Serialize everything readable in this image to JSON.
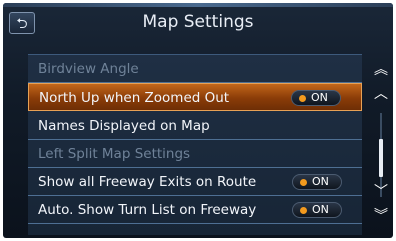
{
  "header": {
    "title": "Map Settings",
    "back_icon": "return-arrow-icon"
  },
  "settings": [
    {
      "label": "Birdview Angle",
      "state": "disabled",
      "toggle": null
    },
    {
      "label": "North Up when Zoomed Out",
      "state": "selected",
      "toggle": "ON"
    },
    {
      "label": "Names Displayed on Map",
      "state": "normal",
      "toggle": null
    },
    {
      "label": "Left Split Map Settings",
      "state": "disabled",
      "toggle": null
    },
    {
      "label": "Show all Freeway Exits on Route",
      "state": "normal",
      "toggle": "ON"
    },
    {
      "label": "Auto. Show Turn List on Freeway",
      "state": "normal",
      "toggle": "ON"
    }
  ],
  "scrollbar": {
    "icons": [
      "double-up-arrow-icon",
      "up-arrow-icon",
      "down-arrow-icon",
      "double-down-arrow-icon"
    ]
  },
  "colors": {
    "accent": "#f39a1e",
    "selected_row": "#b3561a",
    "background": "#111b28"
  }
}
